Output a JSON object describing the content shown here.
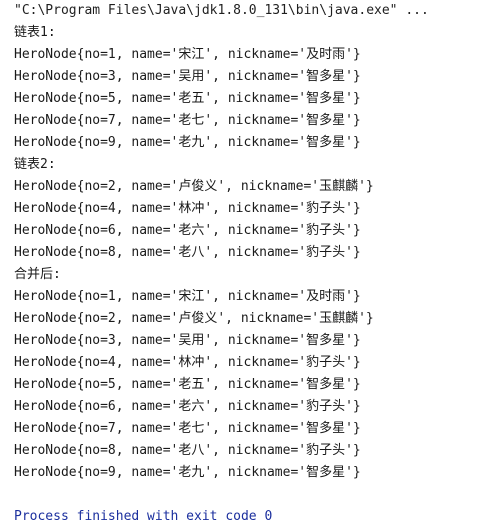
{
  "console": {
    "command_line": "\"C:\\Program Files\\Java\\jdk1.8.0_131\\bin\\java.exe\" ...",
    "output_lines": [
      "链表1:",
      "HeroNode{no=1, name='宋江', nickname='及时雨'}",
      "HeroNode{no=3, name='吴用', nickname='智多星'}",
      "HeroNode{no=5, name='老五', nickname='智多星'}",
      "HeroNode{no=7, name='老七', nickname='智多星'}",
      "HeroNode{no=9, name='老九', nickname='智多星'}",
      "链表2:",
      "HeroNode{no=2, name='卢俊义', nickname='玉麒麟'}",
      "HeroNode{no=4, name='林冲', nickname='豹子头'}",
      "HeroNode{no=6, name='老六', nickname='豹子头'}",
      "HeroNode{no=8, name='老八', nickname='豹子头'}",
      "合并后:",
      "HeroNode{no=1, name='宋江', nickname='及时雨'}",
      "HeroNode{no=2, name='卢俊义', nickname='玉麒麟'}",
      "HeroNode{no=3, name='吴用', nickname='智多星'}",
      "HeroNode{no=4, name='林冲', nickname='豹子头'}",
      "HeroNode{no=5, name='老五', nickname='智多星'}",
      "HeroNode{no=6, name='老六', nickname='豹子头'}",
      "HeroNode{no=7, name='老七', nickname='智多星'}",
      "HeroNode{no=8, name='老八', nickname='豹子头'}",
      "HeroNode{no=9, name='老九', nickname='智多星'}"
    ],
    "exit_message": "Process finished with exit code 0"
  }
}
